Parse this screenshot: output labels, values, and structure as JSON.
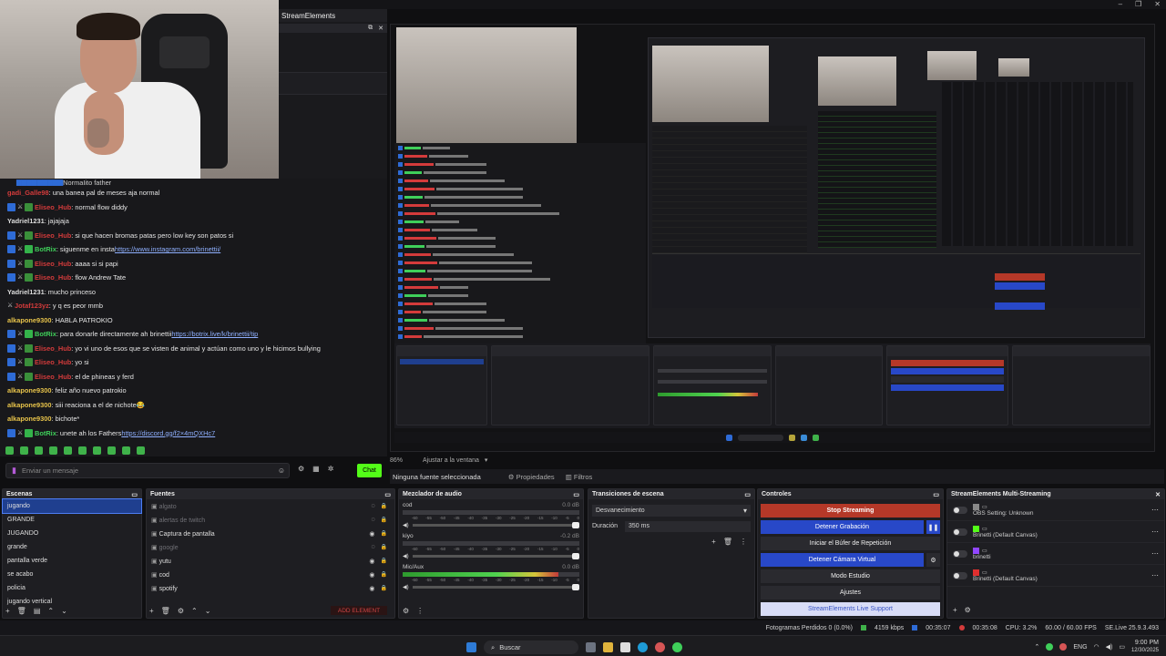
{
  "window": {
    "title": "StreamElements",
    "controls": [
      "–",
      "❐",
      "✕"
    ]
  },
  "chat": {
    "top_partial": "NormaIito father",
    "messages": [
      {
        "user": "gadi_Galle98",
        "user_color": "#d43b3b",
        "text": ": una banea pal de meses aja normal",
        "badges": 0
      },
      {
        "user": "Eliseo_Hub",
        "user_color": "#d43b3b",
        "text": ": normal flow diddy",
        "badges": 2
      },
      {
        "user": "Yadriel1231",
        "user_color": "#dcdcdc",
        "text": ": jajajaja",
        "badges": 0
      },
      {
        "user": "Eliseo_Hub",
        "user_color": "#d43b3b",
        "text": ": si que hacen bromas patas pero low key son patos si",
        "badges": 2
      },
      {
        "user": "BotRix",
        "user_color": "#3fcf5a",
        "text": ": siguenme en insta ",
        "link": "https://www.instagram.com/brinettii/",
        "badges": 3
      },
      {
        "user": "Eliseo_Hub",
        "user_color": "#d43b3b",
        "text": ": aaaa si si papi",
        "badges": 2
      },
      {
        "user": "Eliseo_Hub",
        "user_color": "#d43b3b",
        "text": ": flow Andrew Tate",
        "badges": 2
      },
      {
        "user": "Yadriel1231",
        "user_color": "#dcdcdc",
        "text": ": mucho princeso",
        "badges": 0
      },
      {
        "user": "Jotaf123yz",
        "user_color": "#d43b3b",
        "text": ": y q es peor mmb",
        "badges": 1
      },
      {
        "user": "alkapone9300",
        "user_color": "#e6c24a",
        "text": ": HABLA PATROKIO",
        "badges": 0
      },
      {
        "user": "BotRix",
        "user_color": "#3fcf5a",
        "text": ": para donarle directamente ah brinettii ",
        "link": "https://botrix.live/k/brinettii/tip",
        "badges": 3
      },
      {
        "user": "Eliseo_Hub",
        "user_color": "#d43b3b",
        "text": ": yo vi uno de esos que se visten de animal y actúan como uno y le hicimos bullying",
        "badges": 2
      },
      {
        "user": "Eliseo_Hub",
        "user_color": "#d43b3b",
        "text": ": yo si",
        "badges": 2
      },
      {
        "user": "Eliseo_Hub",
        "user_color": "#d43b3b",
        "text": ": el de phineas y ferd",
        "badges": 2
      },
      {
        "user": "alkapone9300",
        "user_color": "#e6c24a",
        "text": ": feliz año nuevo patrokio",
        "badges": 0
      },
      {
        "user": "alkapone9300",
        "user_color": "#e6c24a",
        "text": ": siii reaciona a el de nichote😂",
        "badges": 0
      },
      {
        "user": "alkapone9300",
        "user_color": "#e6c24a",
        "text": ": bichote*",
        "badges": 0
      },
      {
        "user": "BotRix",
        "user_color": "#3fcf5a",
        "text": ": unete ah los Fathers ",
        "link": "https://discord.gg/f2×4mQXHc7",
        "badges": 3
      }
    ],
    "input_placeholder": "Enviar un mensaje",
    "chat_button": "Chat",
    "emote_count": 10
  },
  "source_bar": {
    "no_source": "Ninguna fuente seleccionada",
    "properties": "Propiedades",
    "filters": "Filtros"
  },
  "preview": {
    "zoom": "86%",
    "fit": "Ajustar a la ventana"
  },
  "scenes": {
    "title": "Escenas",
    "items": [
      "jugando",
      "GRANDE",
      "JUGANDO",
      "grande",
      "pantalla verde",
      "se acabo",
      "policia",
      "jugando vertical"
    ],
    "selected": 0
  },
  "sources": {
    "title": "Fuentes",
    "items": [
      {
        "name": "algato",
        "dim": true
      },
      {
        "name": "alertas de twitch",
        "dim": true
      },
      {
        "name": "Captura de pantalla",
        "dim": false
      },
      {
        "name": "google",
        "dim": true
      },
      {
        "name": "yutu",
        "dim": false
      },
      {
        "name": "cod",
        "dim": false
      },
      {
        "name": "spotify",
        "dim": false
      }
    ],
    "add_element": "ADD ELEMENT"
  },
  "mixer": {
    "title": "Mezclador de audio",
    "channels": [
      {
        "name": "cod",
        "db": "0.0 dB",
        "level": 0
      },
      {
        "name": "kiyo",
        "db": "-0.2 dB",
        "level": 0
      },
      {
        "name": "Mic/Aux",
        "db": "0.0 dB",
        "level": 0.88
      }
    ],
    "scale": [
      "-60",
      "-55",
      "-50",
      "-45",
      "-40",
      "-35",
      "-30",
      "-25",
      "-20",
      "-15",
      "-10",
      "-5",
      "0"
    ]
  },
  "transitions": {
    "title": "Transiciones de escena",
    "selected": "Desvanecimiento",
    "duration_label": "Duración",
    "duration": "350 ms"
  },
  "controls": {
    "title": "Controles",
    "stop_streaming": "Stop Streaming",
    "stop_recording": "Detener Grabación",
    "replay_buffer": "Iniciar el Búfer de Repetición",
    "virtual_cam": "Detener Cámara Virtual",
    "studio_mode": "Modo Estudio",
    "settings": "Ajustes",
    "support": "StreamElements Live Support"
  },
  "multistream": {
    "title": "StreamElements Multi-Streaming",
    "entries": [
      {
        "label": "OBS Setting: Unknown",
        "sub": ""
      },
      {
        "label": "Brinetti (Default Canvas)",
        "sub": "kick"
      },
      {
        "label": "brinetti",
        "sub": "twitch"
      },
      {
        "label": "Brinetti (Default Canvas)",
        "sub": "youtube"
      }
    ]
  },
  "status": {
    "dropped": "Fotogramas Perdidos 0 (0.0%)",
    "bitrate": "4159 kbps",
    "stream_time": "00:35:07",
    "rec_time": "00:35:08",
    "cpu": "CPU: 3.2%",
    "fps": "60.00 / 60.00 FPS",
    "version": "SE.Live 25.9.3.493"
  },
  "taskbar": {
    "search": "Buscar",
    "lang": "ENG",
    "time": "9:00 PM",
    "date": "12/30/2025"
  }
}
